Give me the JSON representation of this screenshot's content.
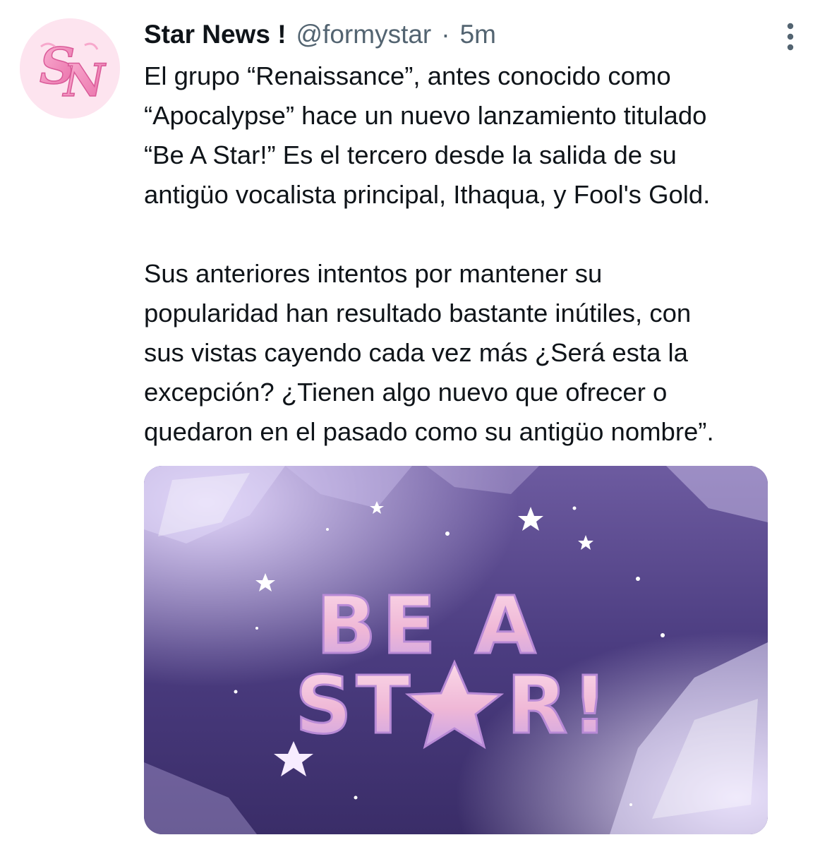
{
  "tweet": {
    "author": {
      "display_name": "Star News !",
      "handle": "@formystar",
      "avatar_monogram": "SN"
    },
    "separator": "·",
    "time": "5m",
    "more_icon": "more-vertical-icon",
    "paragraphs": [
      {
        "lines": [
          "El grupo “Renaissance”, antes conocido como",
          "“Apocalypse” hace un nuevo lanzamiento titulado",
          "“Be A Star!” Es el tercero desde la salida de su",
          "antigüo vocalista principal, Ithaqua, y Fool's Gold."
        ]
      },
      {
        "lines": [
          "Sus anteriores intentos por mantener su",
          "popularidad han resultado bastante inútiles, con",
          "sus vistas cayendo cada vez más ¿Será esta la",
          "excepción? ¿Tienen algo nuevo que ofrecer o",
          "quedaron en el pasado como su antigüo nombre”."
        ]
      }
    ],
    "media": {
      "art_line_1": "BE A",
      "art_line_2_start": "ST",
      "art_line_2_end": "R!"
    }
  },
  "colors": {
    "text_primary": "#0f1419",
    "text_secondary": "#536471",
    "avatar_bg": "#fde0ee",
    "avatar_letters": "#f28bbf",
    "media_bg_top": "#7a6aa8",
    "media_bg_bottom": "#3b2e66",
    "art_pink": "#f7c6dc"
  }
}
